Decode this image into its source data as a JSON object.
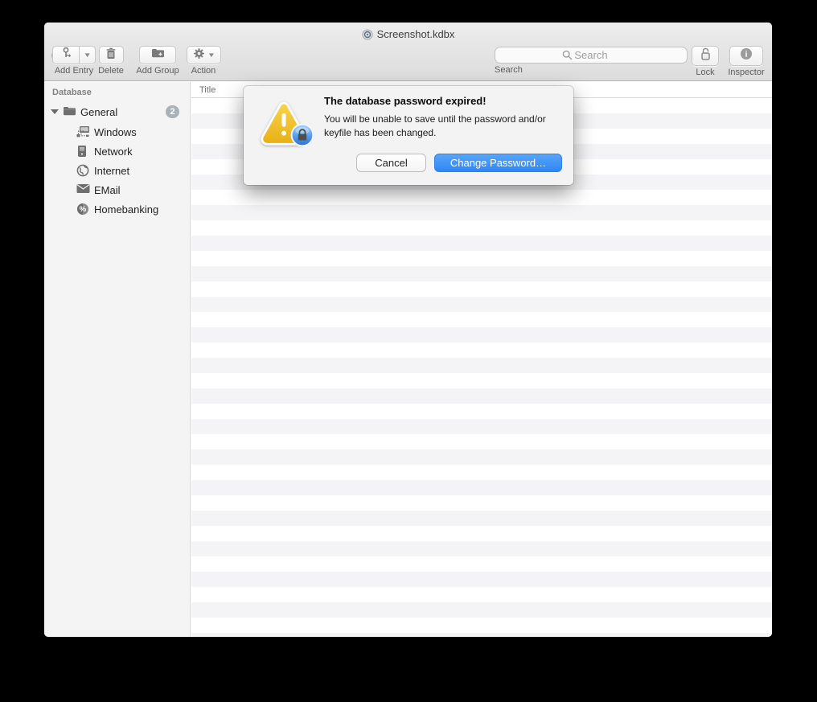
{
  "window": {
    "title": "Screenshot.kdbx"
  },
  "toolbar": {
    "add_entry_label": "Add Entry",
    "delete_label": "Delete",
    "add_group_label": "Add Group",
    "action_label": "Action",
    "search_placeholder": "Search",
    "search_label": "Search",
    "lock_label": "Lock",
    "inspector_label": "Inspector"
  },
  "sidebar": {
    "header": "Database",
    "group": {
      "label": "General",
      "badge": "2"
    },
    "items": [
      {
        "label": "Windows",
        "icon": "windows-network-icon"
      },
      {
        "label": "Network",
        "icon": "server-icon"
      },
      {
        "label": "Internet",
        "icon": "globe-icon"
      },
      {
        "label": "EMail",
        "icon": "envelope-icon"
      },
      {
        "label": "Homebanking",
        "icon": "percent-coin-icon"
      }
    ]
  },
  "table": {
    "column_header": "Title"
  },
  "dialog": {
    "title": "The database password expired!",
    "body": "You will be unable to save until the password and/or keyfile has been changed.",
    "cancel_label": "Cancel",
    "confirm_label": "Change Password…"
  },
  "colors": {
    "accent_blue": "#2f87f5",
    "accent_blue_light": "#58a5f8",
    "warning_yellow": "#f1c232",
    "warning_yellow_dark": "#e6a817",
    "badge_gray": "#a9b1b9",
    "traffic_gray": "#c9c9c9",
    "traffic_yellow": "#f6b231",
    "traffic_green": "#39c74a"
  }
}
